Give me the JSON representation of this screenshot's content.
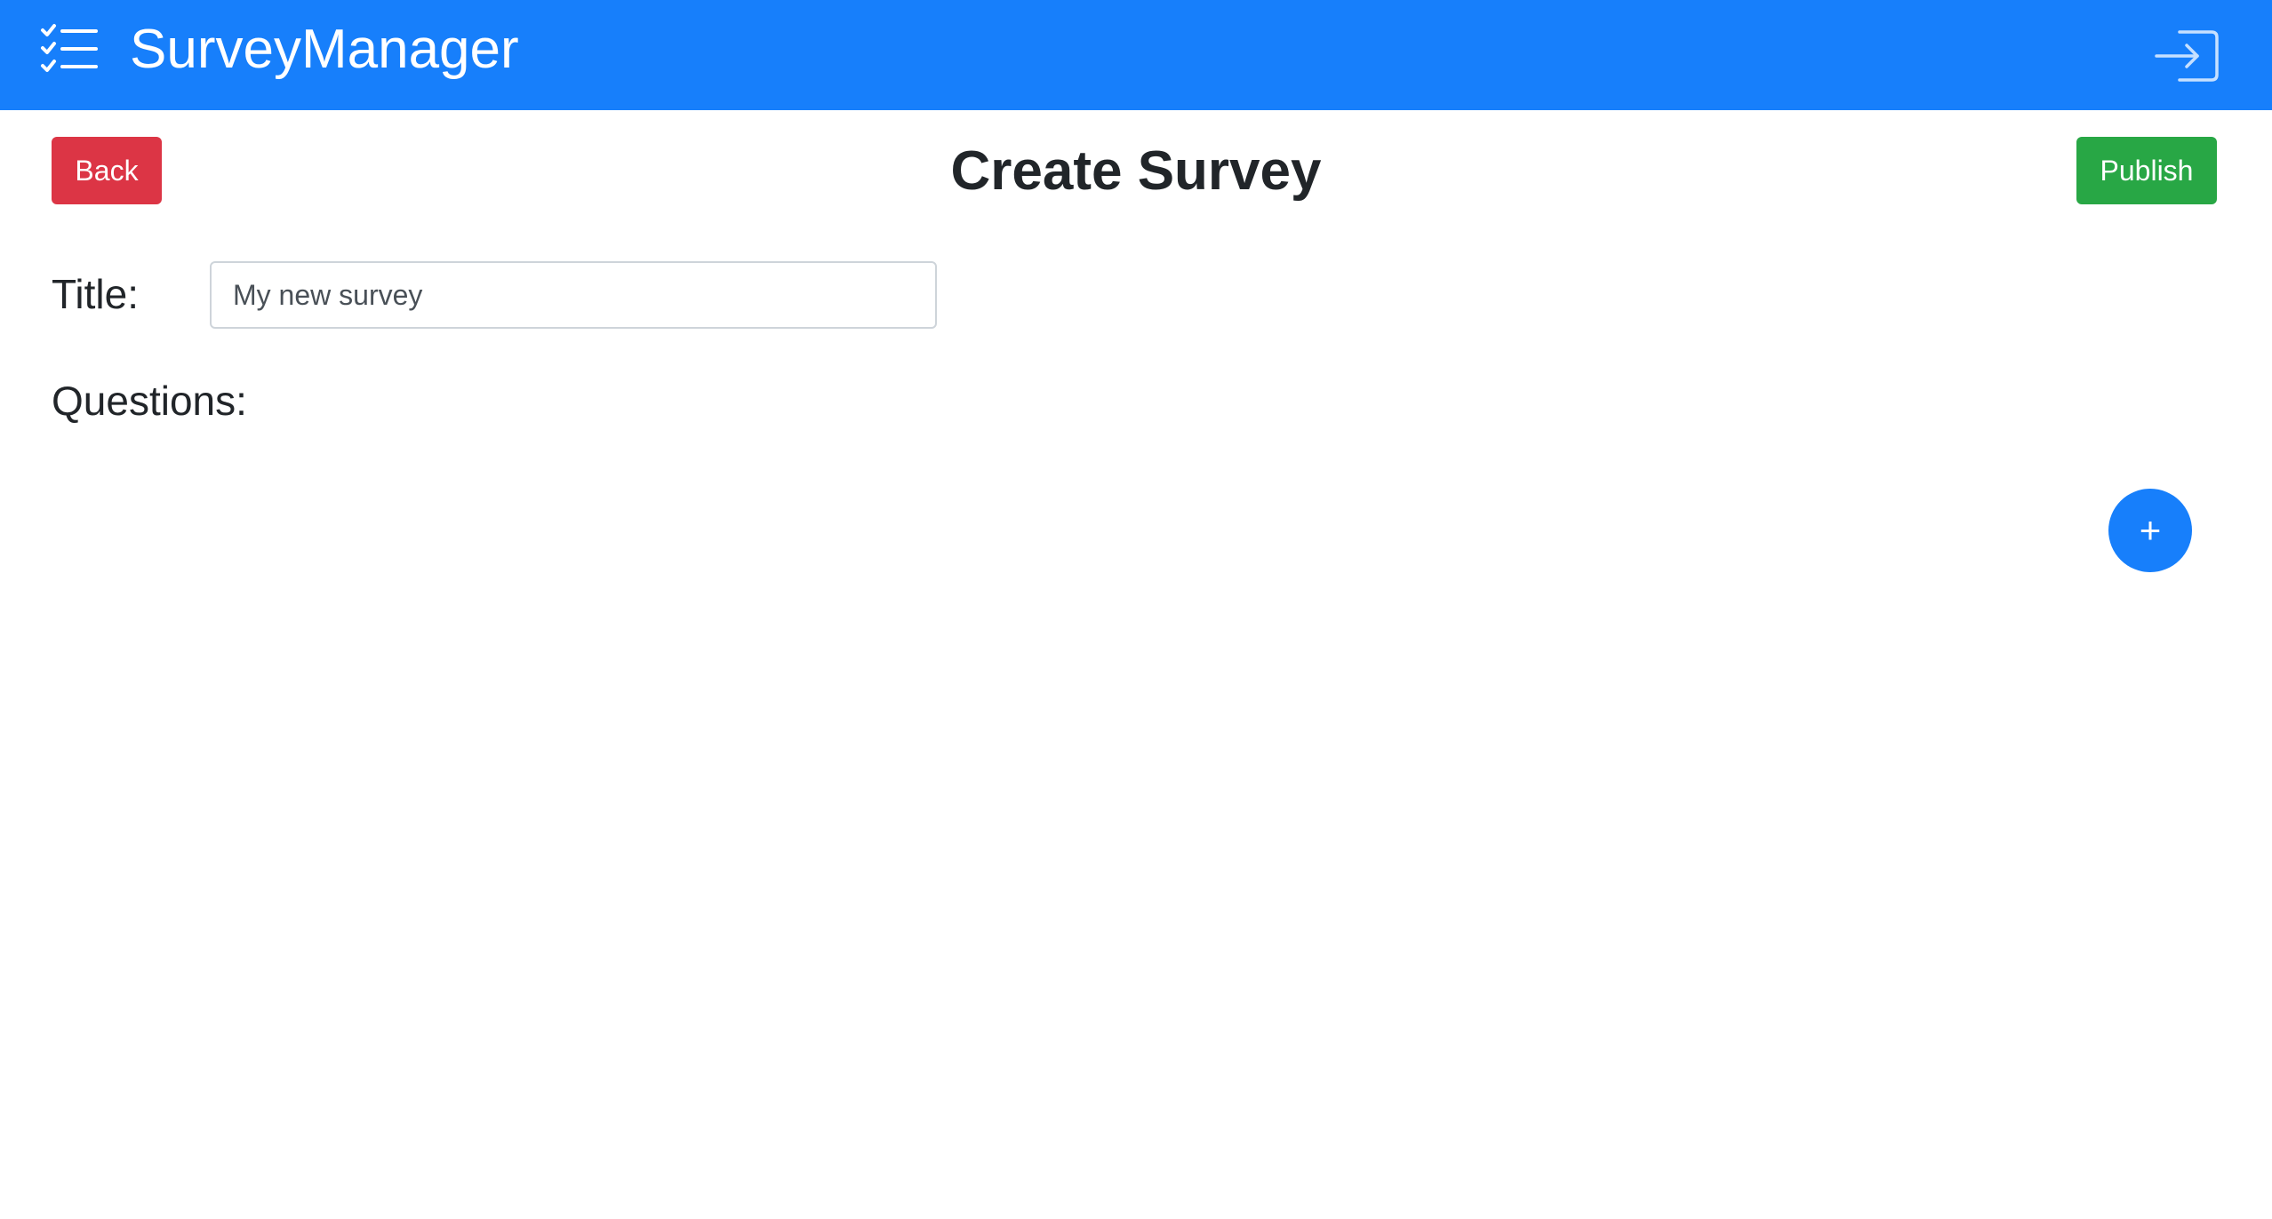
{
  "navbar": {
    "brand": "SurveyManager",
    "brand_icon": "checklist-icon",
    "login_icon": "login-icon",
    "background_color": "#177ffb"
  },
  "page": {
    "title": "Create Survey"
  },
  "actions": {
    "back_label": "Back",
    "back_color": "#dc3545",
    "publish_label": "Publish",
    "publish_color": "#28a745",
    "add_question_label": "+",
    "add_question_color": "#177ffb"
  },
  "form": {
    "title_label": "Title:",
    "title_value": "My new survey",
    "questions_label": "Questions:"
  }
}
